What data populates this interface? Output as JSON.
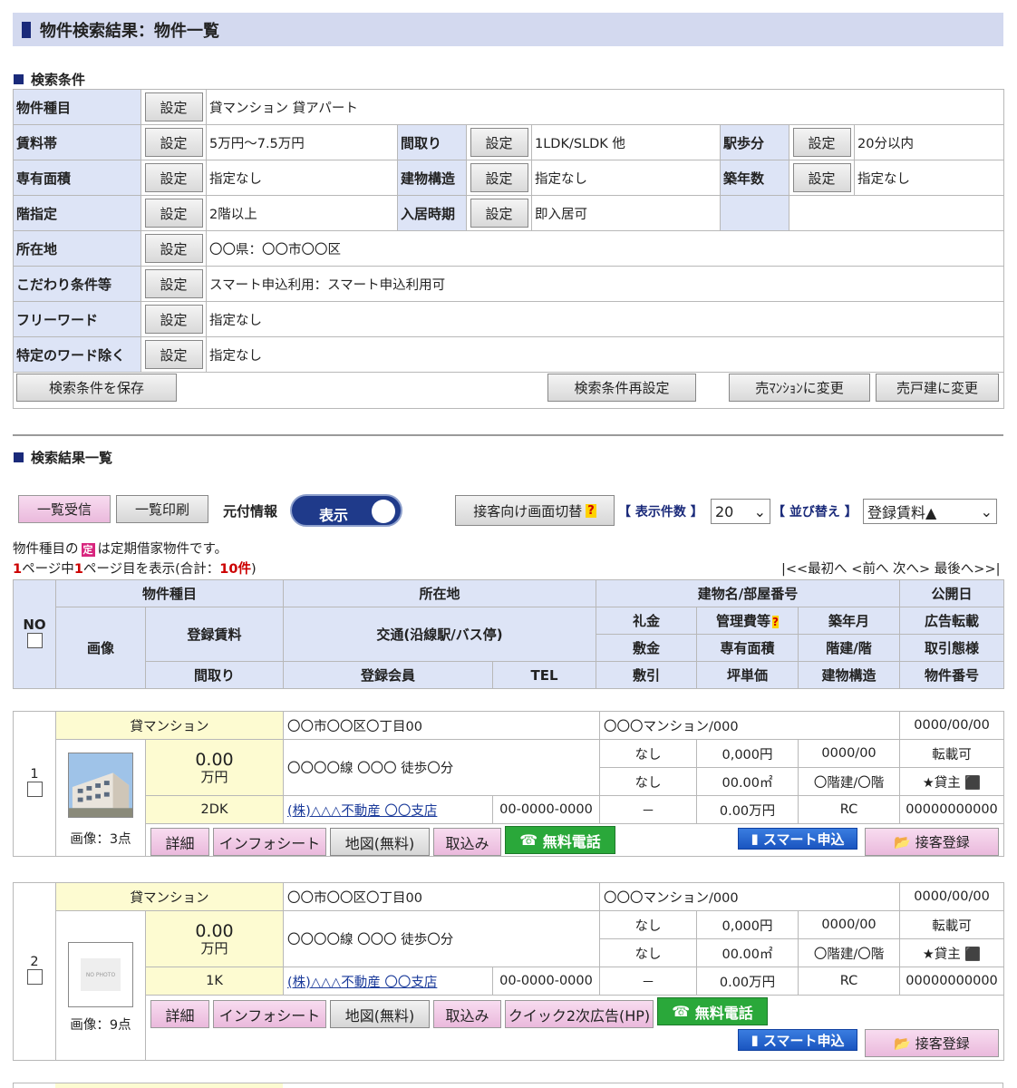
{
  "page_title": "物件検索結果：物件一覧",
  "conditions_heading": "検索条件",
  "set_label": "設定",
  "conditions": {
    "type_label": "物件種目",
    "type_value": "貸マンション 貸アパート",
    "rent_label": "賃料帯",
    "rent_value": "5万円～7.5万円",
    "layout_label": "間取り",
    "layout_value": "1LDK/SLDK 他",
    "walk_label": "駅歩分",
    "walk_value": "20分以内",
    "area_label": "専有面積",
    "area_value": "指定なし",
    "struct_label": "建物構造",
    "struct_value": "指定なし",
    "age_label": "築年数",
    "age_value": "指定なし",
    "floor_label": "階指定",
    "floor_value": "2階以上",
    "move_label": "入居時期",
    "move_value": "即入居可",
    "loc_label": "所在地",
    "loc_value": "〇〇県：〇〇市〇〇区",
    "pref_label": "こだわり条件等",
    "pref_value": "スマート申込利用：スマート申込利用可",
    "free_label": "フリーワード",
    "free_value": "指定なし",
    "excl_label": "特定のワード除く",
    "excl_value": "指定なし"
  },
  "save_btn": "検索条件を保存",
  "reset_btn": "検索条件再設定",
  "to_mansion_btn": "売ﾏﾝｼｮﾝに変更",
  "to_house_btn": "売戸建に変更",
  "results_heading": "検索結果一覧",
  "toolbar": {
    "receive": "一覧受信",
    "print": "一覧印刷",
    "source_label": "元付情報",
    "toggle_label": "表示",
    "switch_btn": "接客向け画面切替",
    "help": "?",
    "count_label": "【 表示件数 】",
    "count_value": "20",
    "sort_label": "【 並び替え 】",
    "sort_value": "登録賃料▲"
  },
  "note1": "は定期借家物件です。",
  "note1_pre": "物件種目の",
  "badge": "定",
  "page_info": {
    "pages": "1",
    "pre": "ページ中",
    "cur": "1",
    "mid": "ページ目を表示(合計：",
    "total": "10件",
    "post": ")"
  },
  "pager": "|<<最初へ <前へ 次へ> 最後へ>>|",
  "headers": {
    "no": "NO",
    "type": "物件種目",
    "loc": "所在地",
    "bld": "建物名/部屋番号",
    "pub": "公開日",
    "img": "画像",
    "rent": "登録賃料",
    "traffic": "交通(沿線駅/バス停)",
    "key": "礼金",
    "mgmt": "管理費等",
    "built": "築年月",
    "ad": "広告転載",
    "deposit": "敷金",
    "area": "専有面積",
    "floors": "階建/階",
    "deal": "取引態様",
    "layout": "間取り",
    "member": "登録会員",
    "tel": "TEL",
    "discount": "敷引",
    "unit": "坪単価",
    "struct": "建物構造",
    "pno": "物件番号"
  },
  "actions": {
    "detail": "詳細",
    "info": "インフォシート",
    "map": "地図(無料)",
    "import": "取込み",
    "quick": "クイック2次広告(HP)",
    "call": "無料電話",
    "smart": "スマート申込",
    "reg": "接客登録"
  },
  "results": [
    {
      "no": "1",
      "type": "貸マンション",
      "loc": "〇〇市〇〇区〇丁目00",
      "bld": "〇〇〇マンション/000",
      "pub": "0000/00/00",
      "rent": "0.00",
      "unit_man": "万円",
      "traffic": "〇〇〇〇線 〇〇〇 徒歩〇分",
      "key": "なし",
      "mgmt": "0,000円",
      "built": "0000/00",
      "ad": "転載可",
      "deposit": "なし",
      "area": "00.00㎡",
      "floors": "〇階建/〇階",
      "deal": "★貸主",
      "layout": "2DK",
      "member": "(株)△△△不動産 〇〇支店",
      "tel": "00-0000-0000",
      "discount": "－",
      "tsubo": "0.00万円",
      "struct": "RC",
      "pno": "00000000000",
      "img_count": "画像：3点"
    },
    {
      "no": "2",
      "type": "貸マンション",
      "loc": "〇〇市〇〇区〇丁目00",
      "bld": "〇〇〇マンション/000",
      "pub": "0000/00/00",
      "rent": "0.00",
      "unit_man": "万円",
      "traffic": "〇〇〇〇線 〇〇〇 徒歩〇分",
      "key": "なし",
      "mgmt": "0,000円",
      "built": "0000/00",
      "ad": "転載可",
      "deposit": "なし",
      "area": "00.00㎡",
      "floors": "〇階建/〇階",
      "deal": "★貸主",
      "layout": "1K",
      "member": "(株)△△△不動産 〇〇支店",
      "tel": "00-0000-0000",
      "discount": "－",
      "tsubo": "0.00万円",
      "struct": "RC",
      "pno": "00000000000",
      "img_count": "画像：9点",
      "no_photo": "NO PHOTO"
    }
  ]
}
